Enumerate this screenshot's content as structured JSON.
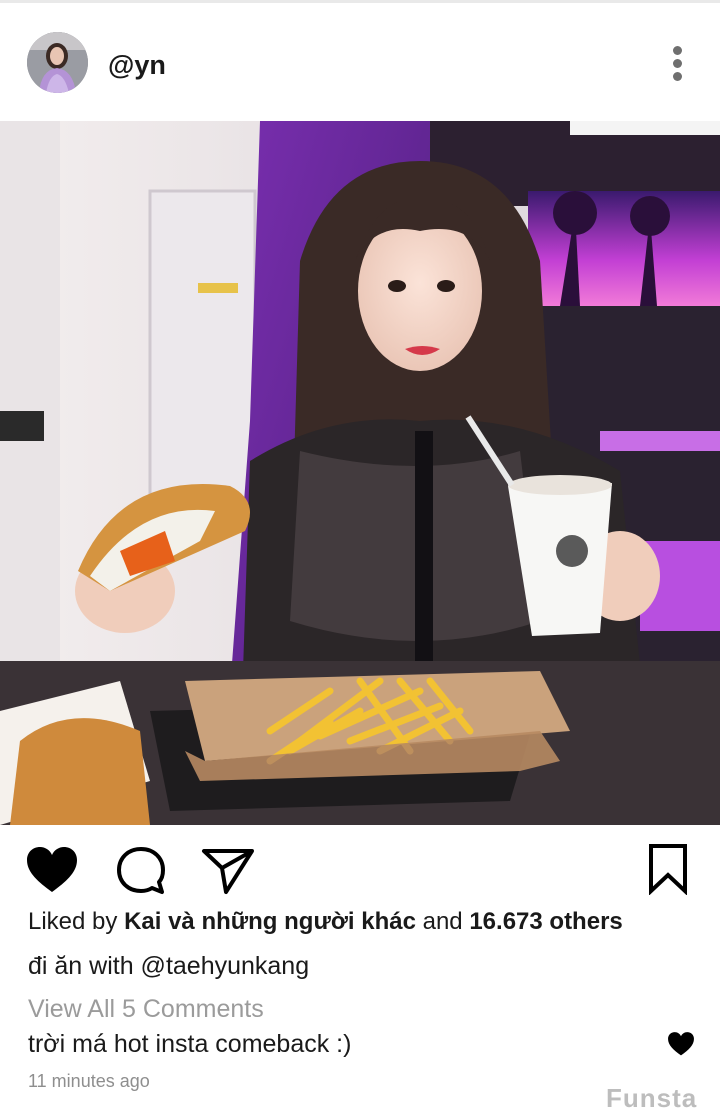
{
  "header": {
    "username": "@yn"
  },
  "post": {
    "liked_by_prefix": "Liked by ",
    "liked_by_user": "Kai và những người khác",
    "liked_by_and": " and ",
    "likes_count": "16.673 others",
    "caption": "đi ăn with @taehyunkang",
    "view_all_comments": "View All 5 Comments",
    "comment_text": "trời má hot insta comeback :)",
    "timestamp": "11 minutes ago",
    "watermark": "Funsta"
  },
  "icons": {
    "more": "more-vertical-icon",
    "like": "heart-filled-icon",
    "comment": "comment-bubble-icon",
    "share": "paper-plane-icon",
    "save": "bookmark-icon",
    "comment_like": "heart-filled-icon"
  },
  "colors": {
    "text": "#1a1a1a",
    "muted": "#9b9b9b",
    "photo_accent": "#8a2bd8"
  }
}
